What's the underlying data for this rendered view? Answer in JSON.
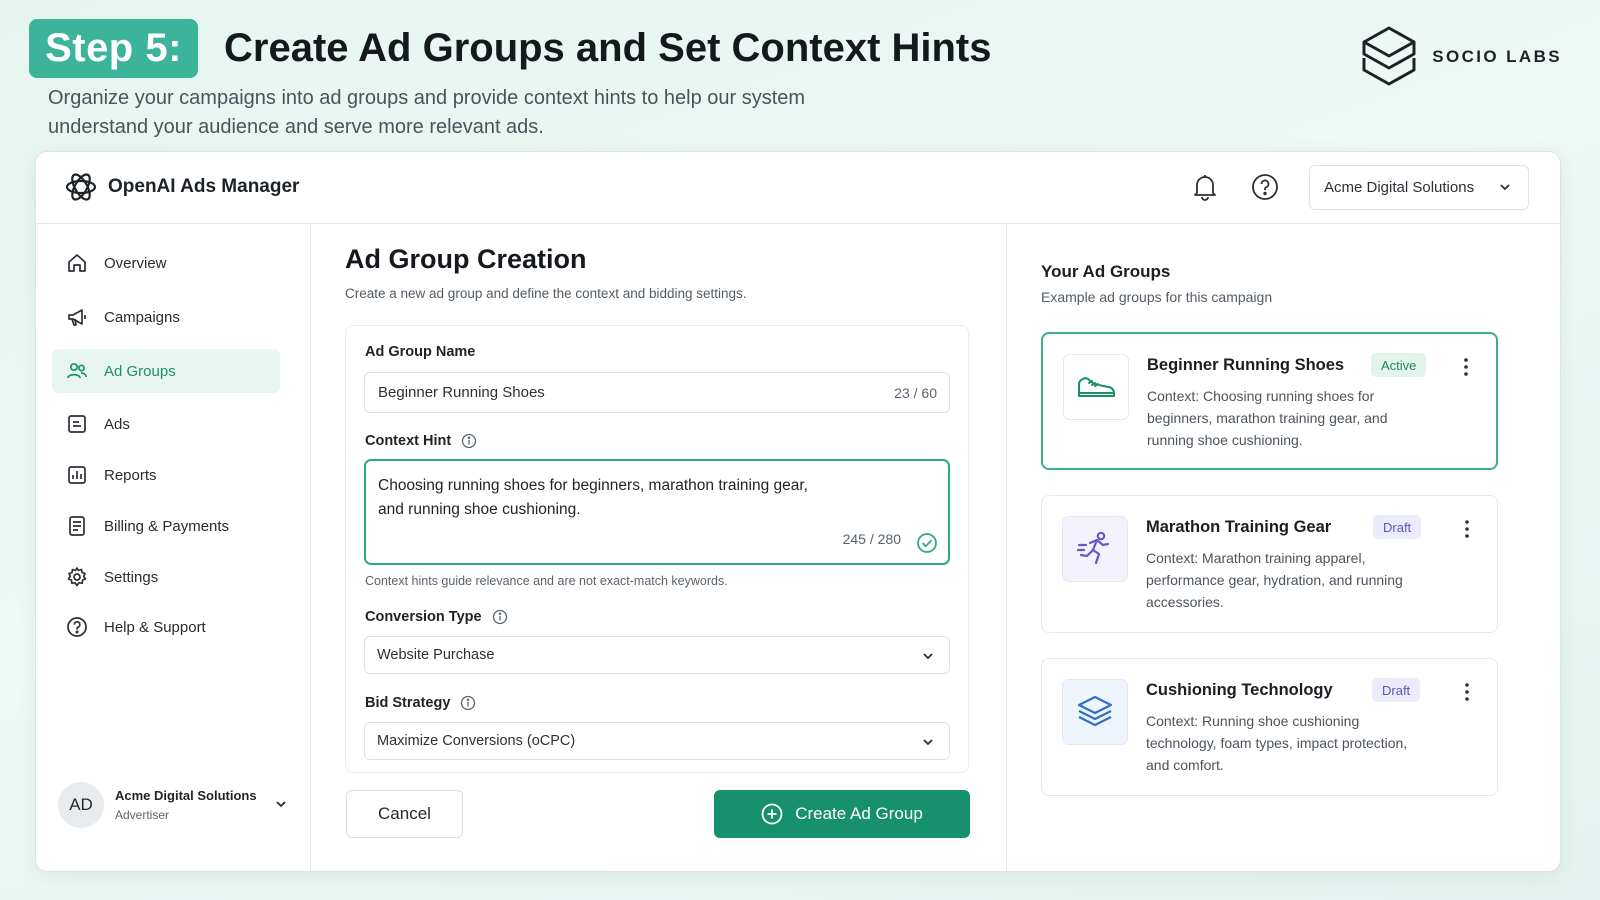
{
  "banner": {
    "step": "Step 5:",
    "title": "Create Ad Groups and Set Context Hints",
    "description": "Organize your campaigns into ad groups and provide context hints to help our system understand your audience and serve more relevant ads.",
    "brand": "SOCIO LABS",
    "brand_icon": "stacked-layers-icon"
  },
  "topbar": {
    "app_title": "OpenAI Ads Manager",
    "logo_icon": "openai-logo-icon",
    "notifications_icon": "bell-icon",
    "help_icon": "question-circle-icon",
    "account": "Acme Digital Solutions"
  },
  "sidebar": {
    "items": [
      {
        "label": "Overview",
        "icon": "home-icon",
        "active": false
      },
      {
        "label": "Campaigns",
        "icon": "megaphone-icon",
        "active": false
      },
      {
        "label": "Ad Groups",
        "icon": "users-icon",
        "active": true
      },
      {
        "label": "Ads",
        "icon": "ad-document-icon",
        "active": false
      },
      {
        "label": "Reports",
        "icon": "bar-chart-icon",
        "active": false
      },
      {
        "label": "Billing & Payments",
        "icon": "receipt-icon",
        "active": false
      },
      {
        "label": "Settings",
        "icon": "gear-icon",
        "active": false
      },
      {
        "label": "Help & Support",
        "icon": "question-circle-icon",
        "active": false
      }
    ],
    "profile": {
      "initials": "AD",
      "name": "Acme Digital Solutions",
      "role": "Advertiser"
    }
  },
  "main": {
    "title": "Ad Group Creation",
    "subtitle": "Create a new ad group and define the context and bidding settings.",
    "ad_group_name": {
      "label": "Ad Group Name",
      "value": "Beginner Running Shoes",
      "counter": "23 / 60"
    },
    "context_hint": {
      "label": "Context Hint",
      "value": "Choosing running shoes for beginners, marathon training gear, and running shoe cushioning.",
      "counter": "245 / 280",
      "helper": "Context hints guide relevance and are not exact-match keywords."
    },
    "conversion_type": {
      "label": "Conversion Type",
      "value": "Website Purchase"
    },
    "bid_strategy": {
      "label": "Bid Strategy",
      "value": "Maximize Conversions (oCPC)"
    },
    "cancel_label": "Cancel",
    "create_label": "Create Ad Group"
  },
  "panel": {
    "title": "Your Ad Groups",
    "subtitle": "Example ad groups for this campaign",
    "groups": [
      {
        "name": "Beginner Running Shoes",
        "status": "Active",
        "icon": "sneaker-icon",
        "context": "Context: Choosing running shoes for beginners, marathon training gear, and running shoe cushioning."
      },
      {
        "name": "Marathon Training Gear",
        "status": "Draft",
        "icon": "runner-icon",
        "context": "Context: Marathon training apparel, performance gear, hydration, and running accessories."
      },
      {
        "name": "Cushioning Technology",
        "status": "Draft",
        "icon": "layers-icon",
        "context": "Context: Running shoe cushioning technology, foam types, impact protection, and comfort."
      }
    ]
  },
  "colors": {
    "accent": "#17916d",
    "badge_teal": "#3cb49a",
    "active_badge_bg": "#e3f4ec",
    "draft_badge_bg": "#ecebfa"
  }
}
